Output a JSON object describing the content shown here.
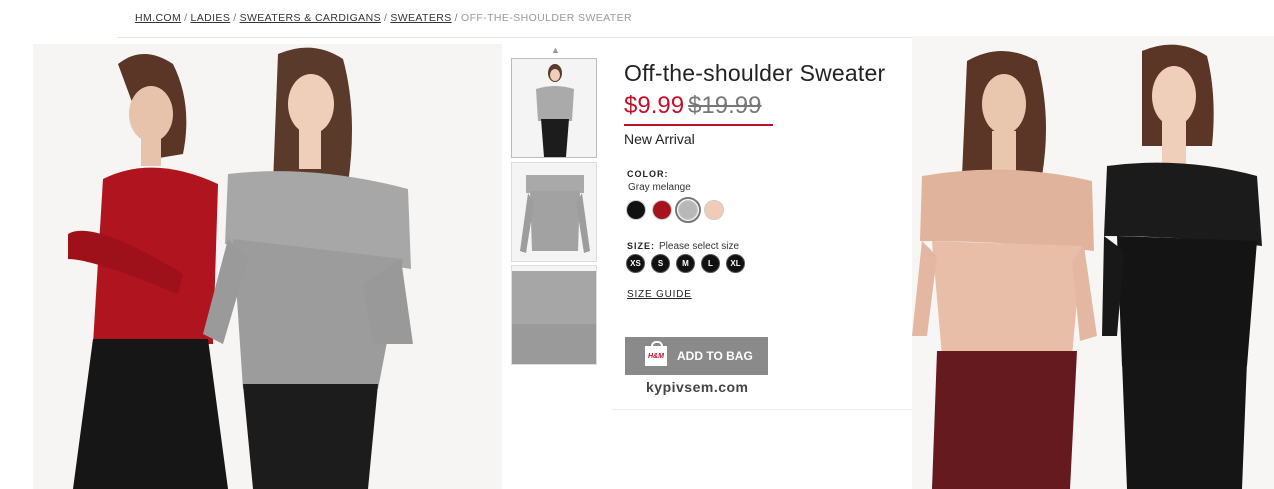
{
  "breadcrumb": {
    "items": [
      "HM.COM",
      "LADIES",
      "SWEATERS & CARDIGANS",
      "SWEATERS"
    ],
    "separator": "/",
    "current": "OFF-THE-SHOULDER SWEATER"
  },
  "product": {
    "title": "Off-the-shoulder Sweater",
    "price_now": "$9.99",
    "price_old": "$19.99",
    "badge": "New Arrival"
  },
  "color": {
    "label": "COLOR:",
    "selected_name": "Gray melange",
    "swatches": [
      {
        "name": "Black",
        "hex": "#111111"
      },
      {
        "name": "Red",
        "hex": "#a8121f"
      },
      {
        "name": "Gray melange",
        "hex": "#b8b8b8"
      },
      {
        "name": "Light pink",
        "hex": "#f2cbb8"
      }
    ]
  },
  "size": {
    "label": "SIZE:",
    "hint": "Please select size",
    "options": [
      "XS",
      "S",
      "M",
      "L",
      "XL"
    ]
  },
  "size_guide": "SIZE GUIDE",
  "add_to_bag": {
    "label": "ADD TO BAG",
    "logo_text": "H&M"
  },
  "watermark": "kypivsem.com",
  "thumbnails": {
    "scroll_up_icon": "chevron-up-icon",
    "count": 3
  },
  "colors": {
    "sale_red": "#c0102a",
    "button_gray": "#8a8a8a"
  }
}
